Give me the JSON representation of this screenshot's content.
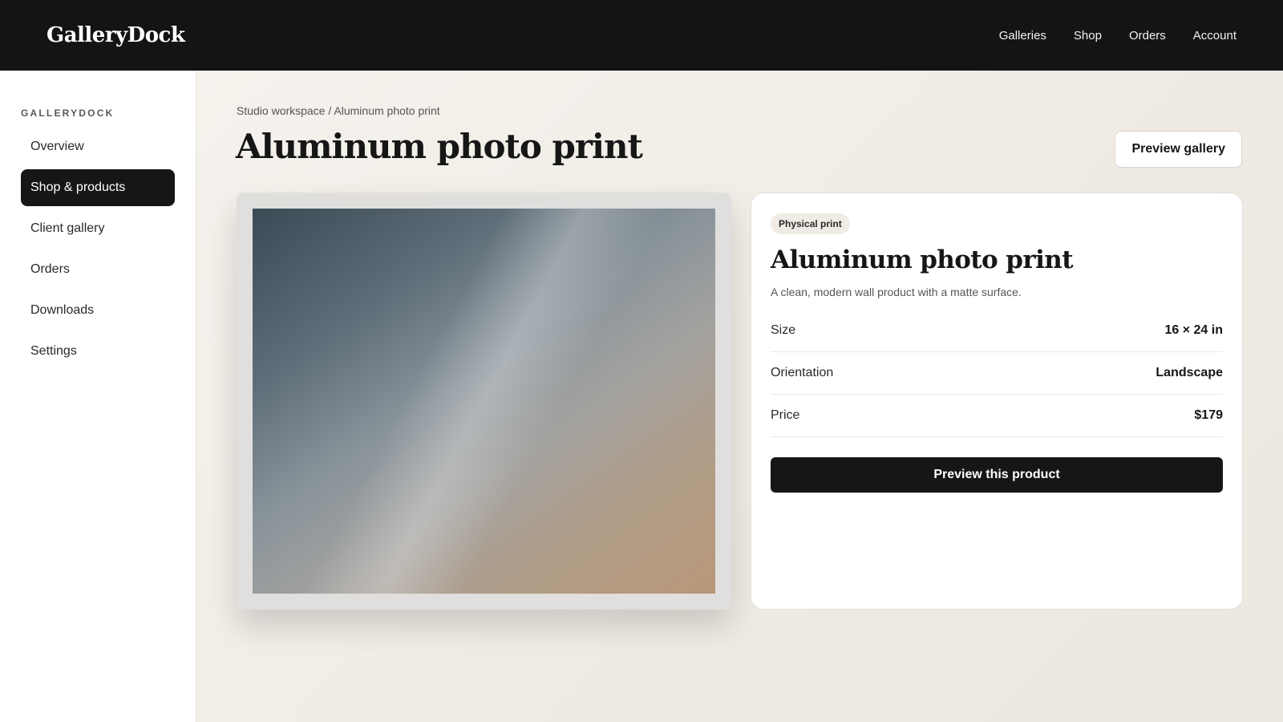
{
  "app": {
    "brand": "GalleryDock"
  },
  "topnav": {
    "items": [
      "Galleries",
      "Shop",
      "Orders",
      "Account"
    ]
  },
  "sidebar": {
    "heading": "GALLERYDOCK",
    "items": [
      {
        "label": "Overview"
      },
      {
        "label": "Shop & products",
        "active": true
      },
      {
        "label": "Client gallery"
      },
      {
        "label": "Orders"
      },
      {
        "label": "Downloads"
      },
      {
        "label": "Settings"
      }
    ]
  },
  "page": {
    "breadcrumb": "Studio workspace / Aluminum photo print",
    "title": "Aluminum photo print",
    "preview_gallery_label": "Preview gallery"
  },
  "product": {
    "badge": "Physical print",
    "title": "Aluminum photo print",
    "description": "A clean, modern wall product with a matte surface.",
    "specs": [
      {
        "label": "Size",
        "value": "16 × 24 in"
      },
      {
        "label": "Orientation",
        "value": "Landscape"
      },
      {
        "label": "Price",
        "value": "$179"
      }
    ],
    "cta_label": "Preview this product"
  },
  "colors": {
    "topbar": "#141414",
    "accent_dark": "#161616",
    "background": "#f4f1ec"
  }
}
